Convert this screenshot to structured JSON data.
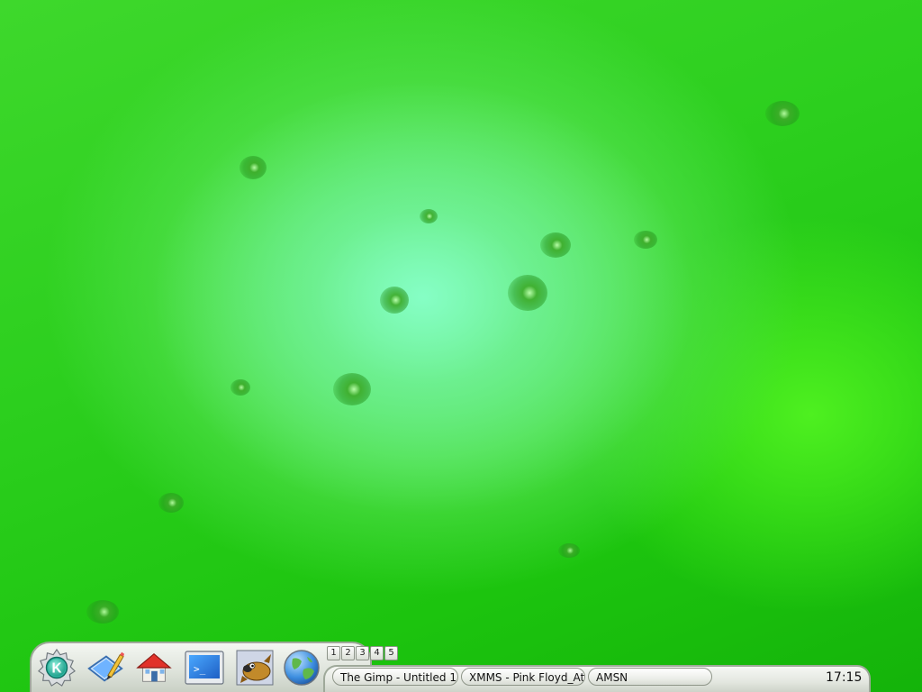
{
  "launchers": [
    {
      "name": "kde-menu",
      "icon": "kde-gear-k-icon"
    },
    {
      "name": "desktop-access",
      "icon": "desktop-pencil-icon"
    },
    {
      "name": "home",
      "icon": "home-house-icon"
    },
    {
      "name": "terminal",
      "icon": "terminal-icon"
    },
    {
      "name": "gimp",
      "icon": "gimp-wilber-icon"
    },
    {
      "name": "web-browser",
      "icon": "globe-icon"
    }
  ],
  "pager": {
    "desktops": [
      "1",
      "2",
      "3",
      "4",
      "5"
    ]
  },
  "taskbar": {
    "tasks": [
      {
        "label": "The Gimp - Untitled 1"
      },
      {
        "label": "XMMS - Pink Floyd_At"
      },
      {
        "label": "AMSN"
      }
    ]
  },
  "clock": {
    "time": "17:15"
  },
  "colors": {
    "wallpaper_center": "#87ffc8",
    "wallpaper_edge": "#14b30a",
    "panel": "#e3e7e0"
  }
}
